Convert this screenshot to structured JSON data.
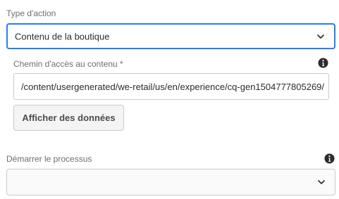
{
  "action_type": {
    "label": "Type d'action",
    "selected": "Contenu de la boutique"
  },
  "content_path": {
    "label": "Chemin d'accès au contenu *",
    "value": "/content/usergenerated/we-retail/us/en/experience/cq-gen1504777805269/",
    "info_icon": "info-icon"
  },
  "show_data_button": {
    "label": "Afficher des données"
  },
  "start_process": {
    "label": "Démarrer le processus",
    "selected": "",
    "info_icon": "info-icon"
  },
  "colors": {
    "focus_border": "#2680eb",
    "border": "#cacaca",
    "label_text": "#6e6e6e",
    "field_text": "#2c2c2c",
    "icon": "#2c2c2c"
  }
}
